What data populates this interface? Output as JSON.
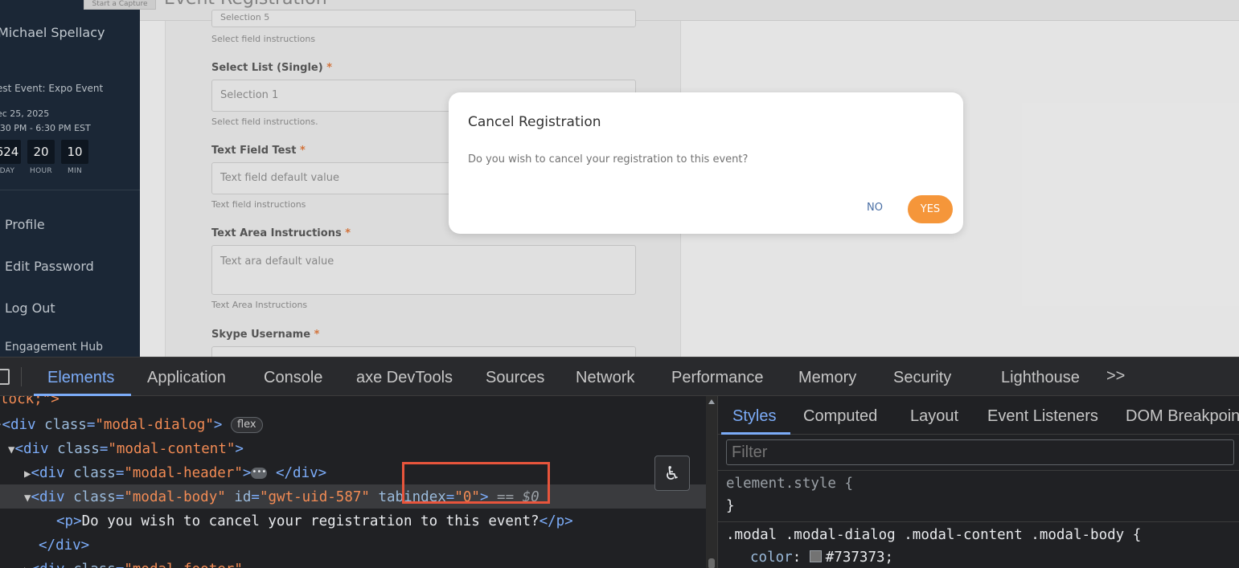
{
  "app": {
    "capture_label": "Start a Capture",
    "page_title": "Event Registration",
    "sidebar": {
      "user_name": "Michael Spellacy",
      "event_name": "est Event: Expo Event",
      "date": "ec 25, 2025",
      "time": ":30 PM - 6:30 PM EST",
      "countdown": [
        {
          "value": "624",
          "label": "DAY"
        },
        {
          "value": "20",
          "label": "HOUR"
        },
        {
          "value": "10",
          "label": "MIN"
        }
      ],
      "nav": [
        "Profile",
        "Edit Password",
        "Log Out",
        "Engagement Hub"
      ]
    },
    "form": {
      "top_select_value": "Selection 5",
      "top_help": "Select field instructions",
      "fields": [
        {
          "label": "Select List (Single)",
          "value": "Selection 1",
          "help": "Select field instructions."
        },
        {
          "label": "Text Field Test",
          "value": "Text field default value",
          "help": "Text field instructions"
        },
        {
          "label": "Text Area Instructions",
          "value": "Text ara default value",
          "help": "Text Area Instructions"
        },
        {
          "label": "Skype Username",
          "value": "",
          "help": ""
        }
      ],
      "required_mark": "*"
    },
    "modal": {
      "title": "Cancel Registration",
      "body": "Do you wish to cancel your registration to this event?",
      "no_label": "NO",
      "yes_label": "YES",
      "yes_color": "#f5963a"
    }
  },
  "devtools": {
    "tabs": [
      "Elements",
      "Application",
      "Console",
      "axe DevTools",
      "Sources",
      "Network",
      "Performance",
      "Memory",
      "Security",
      "Lighthouse"
    ],
    "more_label": ">>",
    "active_tab": "Elements",
    "dom": {
      "line0": "lock;\">",
      "line1_tag": "<div ",
      "line1_attr": "class",
      "line1_val": "\"modal-dialog\"",
      "line1_badge": "flex",
      "line2_attr": "class",
      "line2_val": "\"modal-content\"",
      "line3_attr": "class",
      "line3_val": "\"modal-header\"",
      "line4_class_val": "\"modal-body\"",
      "line4_id_attr": "id",
      "line4_id_val": "\"gwt-uid-587\"",
      "line4_tab_attr": "tabindex",
      "line4_tab_val": "\"0\"",
      "line4_ref": "== $0",
      "line5_text": "Do you wish to cancel your registration to this event?",
      "line6_close": "</div>",
      "line7_attr": "class",
      "line7_val": "\"modal-footer\""
    },
    "styles_panel": {
      "tabs": [
        "Styles",
        "Computed",
        "Layout",
        "Event Listeners",
        "DOM Breakpoin"
      ],
      "active_tab": "Styles",
      "filter_placeholder": "Filter",
      "element_style": "element.style {",
      "close_brace": "}",
      "rule_selector": ".modal .modal-dialog .modal-content .modal-body {",
      "rule_property": "color",
      "rule_value": "#737373;"
    }
  }
}
